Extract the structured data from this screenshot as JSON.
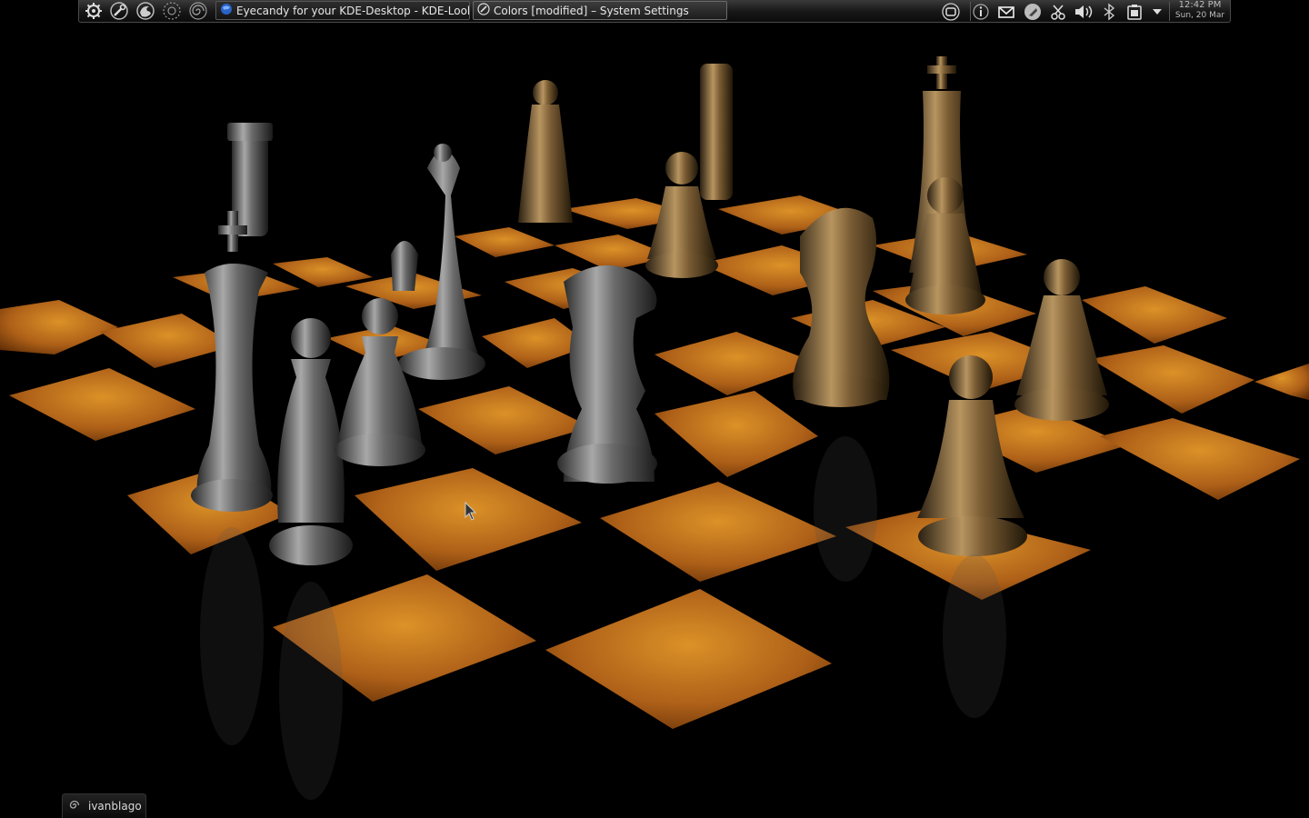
{
  "panel": {
    "launchers": [
      "settings-gear-icon",
      "wrench-icon",
      "firefox-icon",
      "dotted-circle-icon",
      "spiral-icon"
    ],
    "tasks": [
      {
        "label": "Eyecandy for your KDE-Desktop - KDE-Look",
        "icon": "kde-globe-icon"
      },
      {
        "label": "Colors [modified] – System Settings",
        "icon": "system-settings-icon"
      }
    ],
    "tray": [
      "network-icon",
      "info-icon",
      "mail-icon",
      "rocket-icon",
      "scissors-icon",
      "volume-icon",
      "bluetooth-icon",
      "battery-icon",
      "tray-expand-icon"
    ],
    "clock": {
      "time": "12:42 PM",
      "date": "Sun, 20 Mar"
    }
  },
  "user_panel": {
    "username": "ivanblago",
    "icon": "user-swirl-icon"
  },
  "colors": {
    "board_light": "#c97a1c",
    "board_dark": "#050505",
    "panel_bg": "#161616",
    "piece_silver": "#8c8c8c",
    "piece_bronze": "#8a6a3a"
  }
}
